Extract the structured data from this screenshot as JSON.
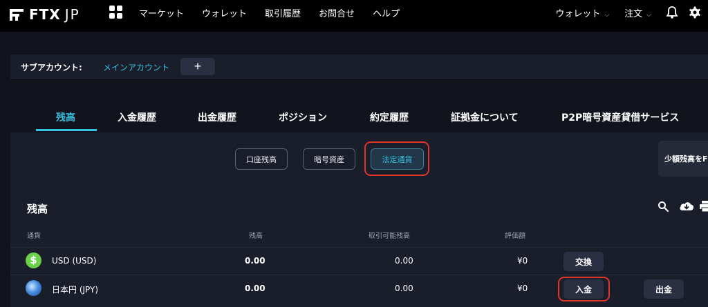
{
  "brand": {
    "name": "FTX",
    "region": "JP"
  },
  "nav": {
    "items": [
      "マーケット",
      "ウォレット",
      "取引履歴",
      "お問合せ",
      "ヘルプ"
    ],
    "wallet_dropdown": "ウォレット",
    "order_dropdown": "注文"
  },
  "subaccount": {
    "label": "サブアカウント:",
    "current": "メインアカウント",
    "add_symbol": "+"
  },
  "tabs": [
    "残高",
    "入金履歴",
    "出金履歴",
    "ポジション",
    "約定履歴",
    "証拠金について",
    "P2P暗号資産貸借サービス"
  ],
  "active_tab": "残高",
  "segments": [
    "口座残高",
    "暗号資産",
    "法定通貨"
  ],
  "active_segment": "法定通貨",
  "small_balance_button": "少額残高をF",
  "section_title": "残高",
  "table": {
    "columns": [
      "通貨",
      "残高",
      "取引可能残高",
      "評価額"
    ],
    "rows": [
      {
        "currency": "USD (USD)",
        "balance": "0.00",
        "available": "0.00",
        "value": "¥0",
        "actions": [
          "交換"
        ]
      },
      {
        "currency": "日本円 (JPY)",
        "balance": "0.00",
        "available": "0.00",
        "value": "¥0",
        "actions": [
          "入金",
          "出金"
        ]
      }
    ]
  },
  "colors": {
    "accent": "#35c2e0",
    "highlight": "#e0352b",
    "background": "#11131d",
    "panel": "#1a1e2b",
    "usd_icon": "#6bd04a"
  }
}
